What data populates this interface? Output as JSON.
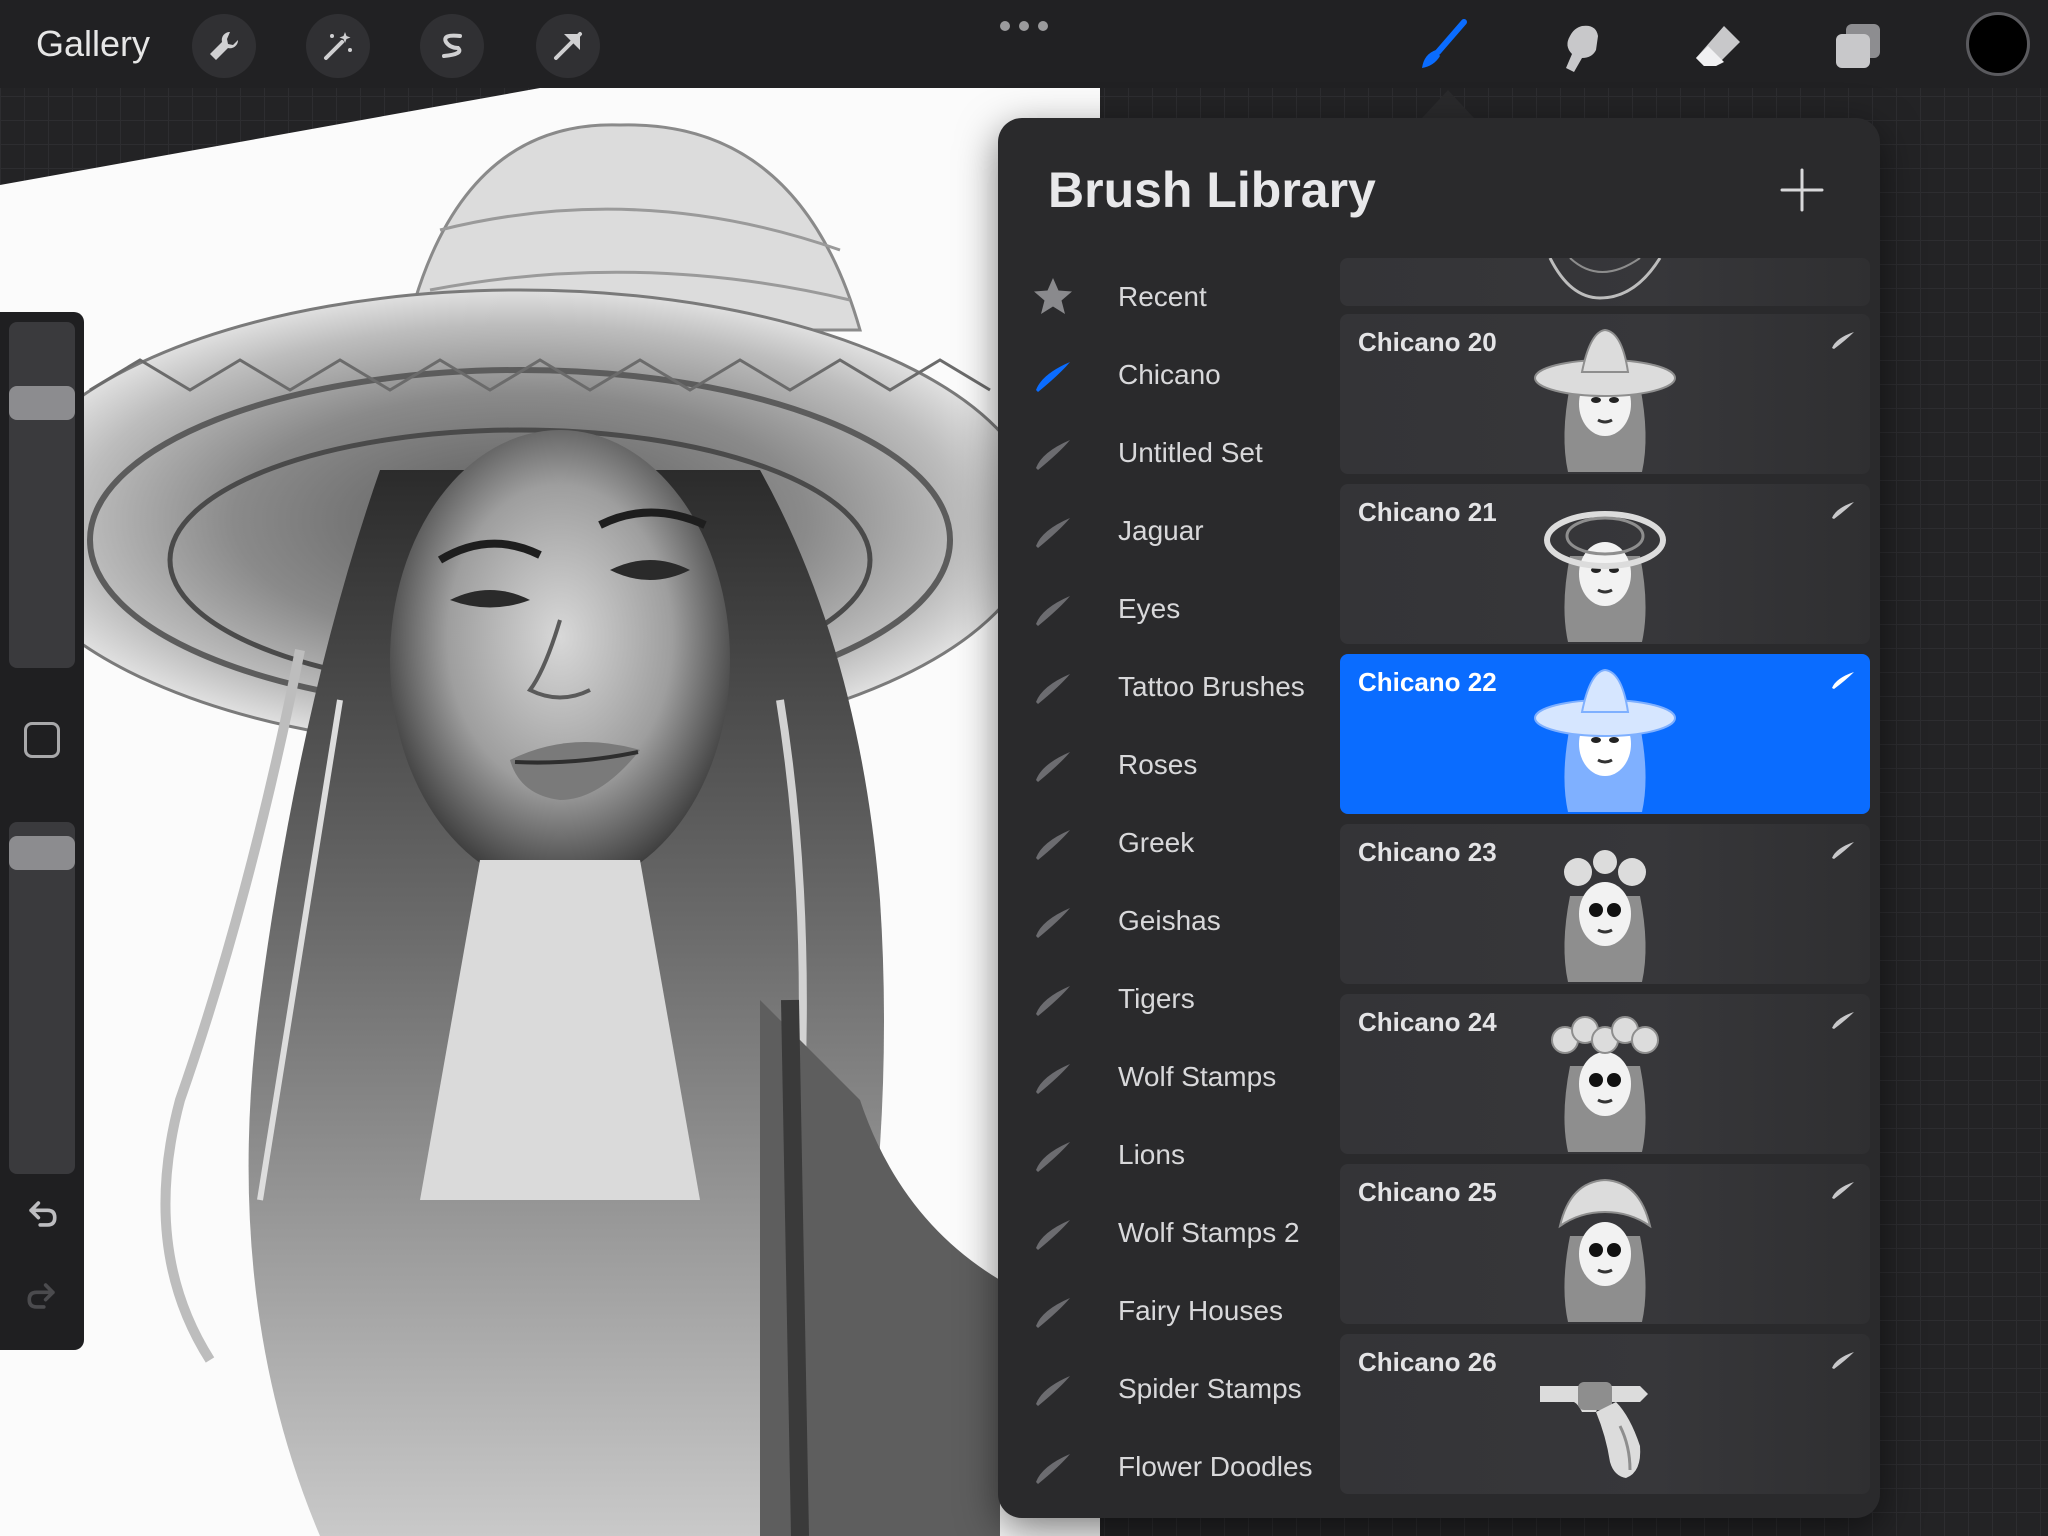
{
  "toolbar": {
    "gallery_label": "Gallery",
    "left_tools": [
      "wrench-icon",
      "magic-wand-icon",
      "selection-s-icon",
      "arrow-transform-icon"
    ],
    "right_tools": [
      "brush-icon",
      "smudge-icon",
      "eraser-icon",
      "layers-icon"
    ],
    "active_tool": "brush-icon",
    "current_color": "#000000",
    "accent_color": "#0a6cff"
  },
  "brush_library": {
    "title": "Brush Library",
    "sets": [
      {
        "label": "Recent",
        "icon": "star-icon"
      },
      {
        "label": "Chicano",
        "icon": "brush-stroke-icon",
        "active": true
      },
      {
        "label": "Untitled Set",
        "icon": "brush-stroke-icon"
      },
      {
        "label": "Jaguar",
        "icon": "brush-stroke-icon"
      },
      {
        "label": "Eyes",
        "icon": "brush-stroke-icon"
      },
      {
        "label": "Tattoo Brushes",
        "icon": "brush-stroke-icon"
      },
      {
        "label": "Roses",
        "icon": "brush-stroke-icon"
      },
      {
        "label": "Greek",
        "icon": "brush-stroke-icon"
      },
      {
        "label": "Geishas",
        "icon": "brush-stroke-icon"
      },
      {
        "label": "Tigers",
        "icon": "brush-stroke-icon"
      },
      {
        "label": "Wolf Stamps",
        "icon": "brush-stroke-icon"
      },
      {
        "label": "Lions",
        "icon": "brush-stroke-icon"
      },
      {
        "label": "Wolf Stamps 2",
        "icon": "brush-stroke-icon"
      },
      {
        "label": "Fairy Houses",
        "icon": "brush-stroke-icon"
      },
      {
        "label": "Spider Stamps",
        "icon": "brush-stroke-icon"
      },
      {
        "label": "Flower Doodles",
        "icon": "brush-stroke-icon"
      }
    ],
    "brushes": [
      {
        "name": "Chicano 20",
        "thumb": "sombrero-woman"
      },
      {
        "name": "Chicano 21",
        "thumb": "hat-woman"
      },
      {
        "name": "Chicano 22",
        "thumb": "sombrero-woman",
        "selected": true
      },
      {
        "name": "Chicano 23",
        "thumb": "catrina"
      },
      {
        "name": "Chicano 24",
        "thumb": "catrina-flowers"
      },
      {
        "name": "Chicano 25",
        "thumb": "catrina-crown"
      },
      {
        "name": "Chicano 26",
        "thumb": "revolver"
      }
    ]
  }
}
